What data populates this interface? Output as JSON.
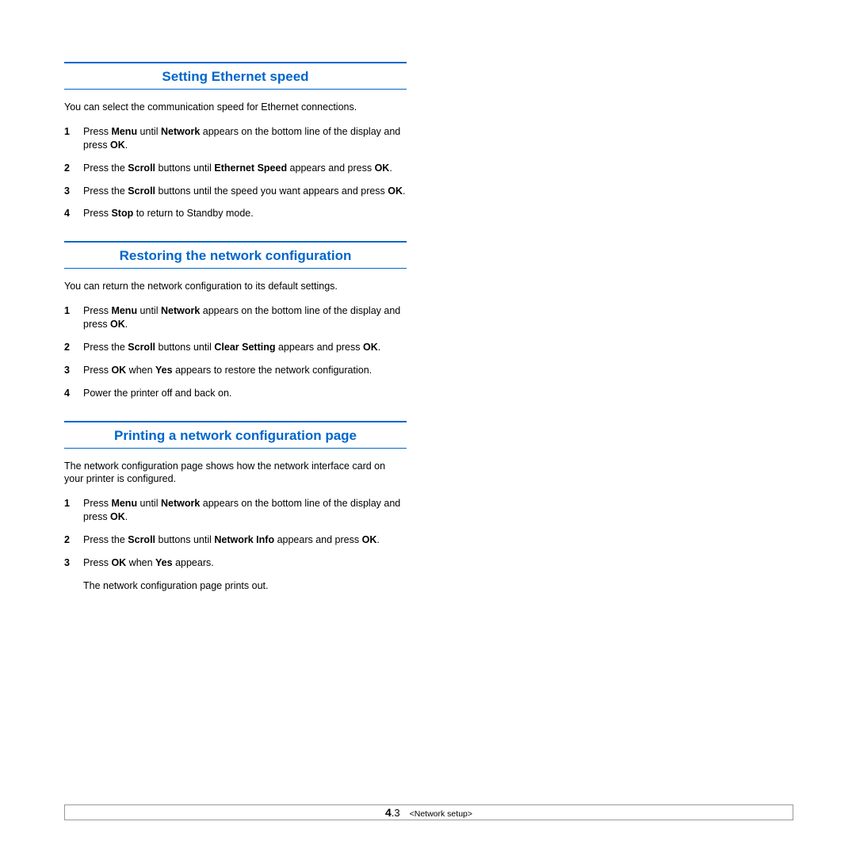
{
  "sections": [
    {
      "heading": "Setting Ethernet speed",
      "intro": "You can select the communication speed for Ethernet connections.",
      "steps": [
        {
          "num": "1",
          "html": "Press <b>Menu</b> until <b>Network</b> appears on the bottom line of the display and press <b>OK</b>."
        },
        {
          "num": "2",
          "html": "Press the <b>Scroll</b> buttons until <b>Ethernet Speed</b> appears and press <b>OK</b>."
        },
        {
          "num": "3",
          "html": "Press the <b>Scroll</b> buttons until the speed you want appears and press <b>OK</b>."
        },
        {
          "num": "4",
          "html": "Press <b>Stop</b> to return to Standby mode."
        }
      ]
    },
    {
      "heading": "Restoring the network configuration",
      "intro": "You can return the network configuration to its default settings.",
      "steps": [
        {
          "num": "1",
          "html": "Press <b>Menu</b> until <b>Network</b> appears on the bottom line of the display and press <b>OK</b>."
        },
        {
          "num": "2",
          "html": "Press the <b>Scroll</b> buttons until <b>Clear Setting</b> appears and press <b>OK</b>."
        },
        {
          "num": "3",
          "html": "Press <b>OK</b> when <b>Yes</b> appears to restore the network configuration."
        },
        {
          "num": "4",
          "html": "Power the printer off and back on."
        }
      ]
    },
    {
      "heading": "Printing a network configuration page",
      "intro": "The network configuration page shows how the network interface card on your printer is configured.",
      "steps": [
        {
          "num": "1",
          "html": "Press <b>Menu</b> until <b>Network</b> appears on the bottom line of the display and press <b>OK</b>."
        },
        {
          "num": "2",
          "html": "Press the <b>Scroll</b> buttons until <b>Network Info</b> appears and press <b>OK</b>."
        },
        {
          "num": "3",
          "html": "Press <b>OK</b> when <b>Yes</b> appears.",
          "note": "The network configuration page prints out."
        }
      ]
    }
  ],
  "footer": {
    "chapter": "4",
    "page": ".3",
    "label": "<Network setup>"
  }
}
